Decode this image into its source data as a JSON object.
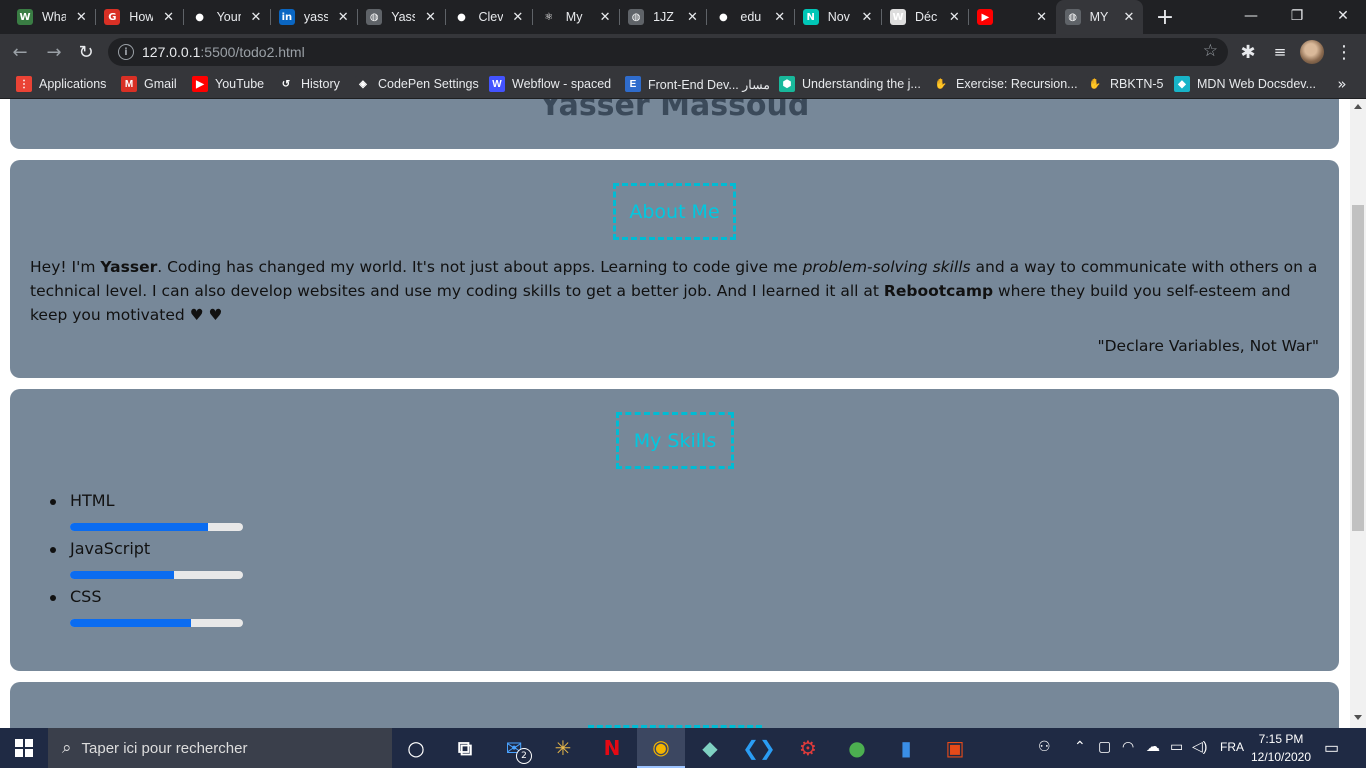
{
  "browser": {
    "tabs": [
      {
        "title": "WhatsApp",
        "icon": "whatsapp-icon",
        "color": "#3a7d44",
        "glyph": "W"
      },
      {
        "title": "How",
        "icon": "google-icon",
        "color": "#d93025",
        "glyph": "G"
      },
      {
        "title": "Your",
        "icon": "github-icon",
        "color": "#202124",
        "glyph": "●"
      },
      {
        "title": "yasser",
        "icon": "linkedin-icon",
        "color": "#0a66c2",
        "glyph": "in"
      },
      {
        "title": "Yasser",
        "icon": "globe-icon",
        "color": "#5f6368",
        "glyph": "◍"
      },
      {
        "title": "Clever",
        "icon": "github-icon",
        "color": "#202124",
        "glyph": "●"
      },
      {
        "title": "My",
        "icon": "react-icon",
        "color": "#202124",
        "glyph": "⚛"
      },
      {
        "title": "1JZ",
        "icon": "globe-icon",
        "color": "#5f6368",
        "glyph": "◍"
      },
      {
        "title": "edu",
        "icon": "github-icon",
        "color": "#202124",
        "glyph": "●"
      },
      {
        "title": "Nov",
        "icon": "netlify-icon",
        "color": "#00c7b7",
        "glyph": "N"
      },
      {
        "title": "Déc",
        "icon": "wikipedia-icon",
        "color": "#dddddd",
        "glyph": "W"
      },
      {
        "title": "",
        "icon": "youtube-icon",
        "color": "#ff0000",
        "glyph": "▶"
      },
      {
        "title": "MY",
        "icon": "globe-icon",
        "color": "#5f6368",
        "glyph": "◍"
      }
    ],
    "url_host": "127.0.0.1",
    "url_path": ":5500/todo2.html",
    "bookmarks": [
      {
        "label": "Applications",
        "icon": "apps-grid-icon",
        "color": "#ea4335",
        "glyph": "⋮"
      },
      {
        "label": "Gmail",
        "icon": "gmail-icon",
        "color": "#d93025",
        "glyph": "M"
      },
      {
        "label": "YouTube",
        "icon": "youtube-icon",
        "color": "#ff0000",
        "glyph": "▶"
      },
      {
        "label": "History",
        "icon": "history-icon",
        "color": "#35363a",
        "glyph": "↺"
      },
      {
        "label": "CodePen Settings",
        "icon": "codepen-icon",
        "color": "#35363a",
        "glyph": "◈"
      },
      {
        "label": "Webflow - spaced",
        "icon": "webflow-icon",
        "color": "#4353ff",
        "glyph": "W"
      },
      {
        "label": "Front-End Dev... مسار",
        "icon": "e-icon",
        "color": "#2f6ccc",
        "glyph": "E"
      },
      {
        "label": "Understanding the j...",
        "icon": "hex-icon",
        "color": "#18b89b",
        "glyph": "⬢"
      },
      {
        "label": "Exercise: Recursion...",
        "icon": "hand-icon",
        "color": "#35363a",
        "glyph": "✋"
      },
      {
        "label": "RBKTN-5",
        "icon": "hand-icon",
        "color": "#35363a",
        "glyph": "✋"
      },
      {
        "label": "MDN Web Docsdev...",
        "icon": "mdn-icon",
        "color": "#18b4c8",
        "glyph": "◆"
      }
    ]
  },
  "page": {
    "header_title": "Yasser Massoud",
    "about": {
      "heading": "About Me",
      "p1": "Hey! I'm ",
      "name": "Yasser",
      "p2": ". Coding has changed my world. It's not just about apps. Learning to code give me ",
      "emph": "problem-solving skills",
      "p3": " and a way to communicate with others on a technical level. I can also develop websites and use my coding skills to get a better job. And I learned it all at ",
      "school": "Rebootcamp",
      "p4": " where they build you self-esteem and keep you motivated ",
      "hearts": "♥ ♥",
      "quote": "\"Declare Variables, Not War\""
    },
    "skills": {
      "heading": "My Skills",
      "items": [
        {
          "name": "HTML",
          "level": 0.8
        },
        {
          "name": "JavaScript",
          "level": 0.6
        },
        {
          "name": "CSS",
          "level": 0.7
        }
      ]
    }
  },
  "taskbar": {
    "search_placeholder": "Taper ici pour rechercher",
    "mail_badge": "2",
    "language": "FRA",
    "time": "7:15 PM",
    "date": "12/10/2020",
    "apps": [
      "cortana-icon",
      "task-view-icon",
      "mail-icon",
      "slack-icon",
      "netflix-icon",
      "chrome-icon",
      "gitkraken-icon",
      "vscode-icon",
      "app-icon",
      "mongodb-icon",
      "file-icon",
      "office-icon"
    ]
  }
}
